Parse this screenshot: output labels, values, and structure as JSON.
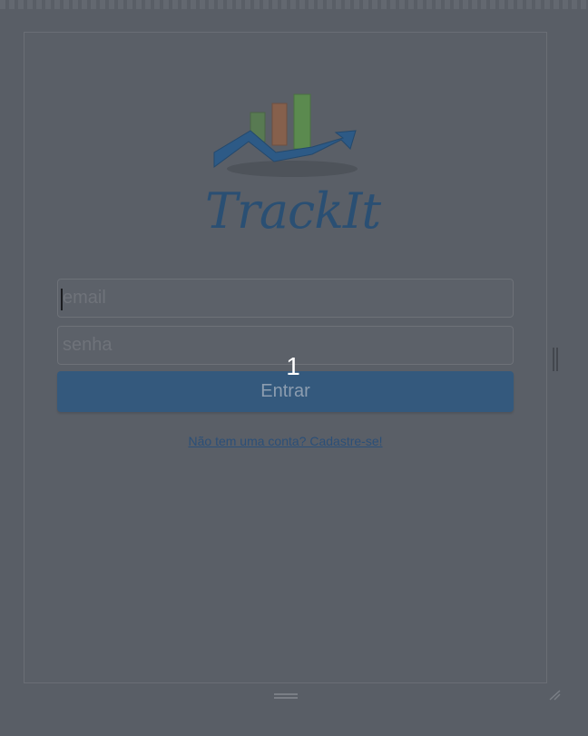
{
  "app": {
    "brand_name": "TrackIt"
  },
  "login_form": {
    "email_placeholder": "email",
    "password_placeholder": "senha",
    "submit_label": "Entrar",
    "signup_link": "Não tem uma conta? Cadastre-se!"
  },
  "overlay": {
    "step_number": "1"
  },
  "colors": {
    "brand_blue": "#2a4f73",
    "button_bg": "#34597d",
    "link": "#2b4f78",
    "bar_green": "#5a8a4a",
    "bar_orange": "#8a5a3c",
    "overlay_dim": "#595e66"
  },
  "icons": {
    "logo": "bar-chart-arrow-logo",
    "scroll_handle": "vertical-scroll-handle",
    "bottom_grip": "drag-grip-icon",
    "resize": "resize-corner-icon"
  }
}
